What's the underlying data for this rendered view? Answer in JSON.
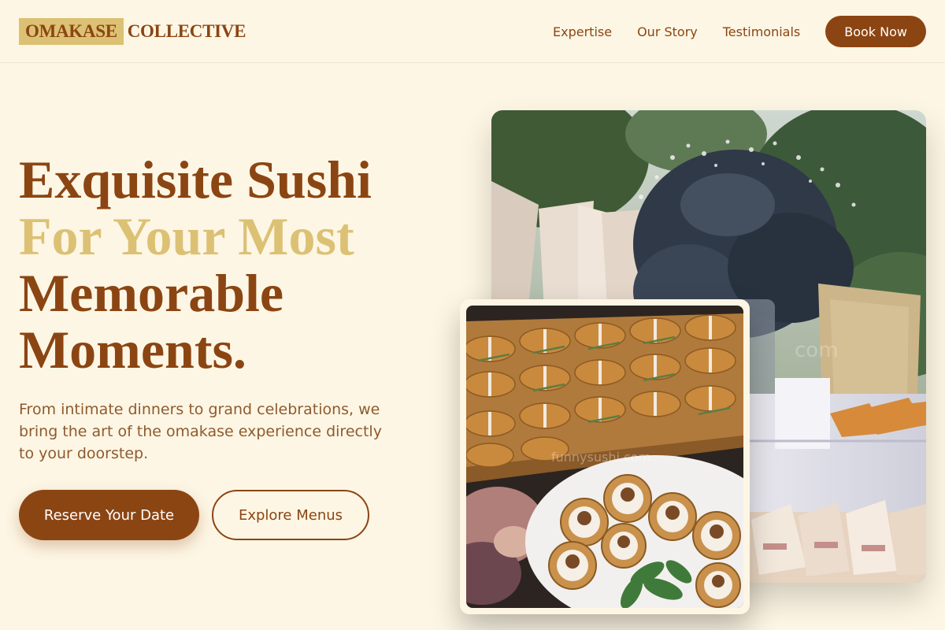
{
  "brand": {
    "highlight": "OMAKASE",
    "rest": "COLLECTIVE"
  },
  "nav": {
    "links": [
      "Expertise",
      "Our Story",
      "Testimonials"
    ],
    "cta": "Book Now"
  },
  "hero": {
    "line1": "Exquisite Sushi",
    "line2": "For Your Most",
    "line3": "Memorable",
    "line4": "Moments.",
    "subtext": "From intimate dinners to grand celebrations, we bring the art of the omakase experience directly to your doorstep.",
    "primary_cta": "Reserve Your Date",
    "secondary_cta": "Explore Menus"
  },
  "images": {
    "front_watermark": "funnysushi.com",
    "back_watermark": "com"
  },
  "colors": {
    "background": "#fdf6e4",
    "brand_brown": "#8b4513",
    "accent_gold": "#dcc174"
  }
}
